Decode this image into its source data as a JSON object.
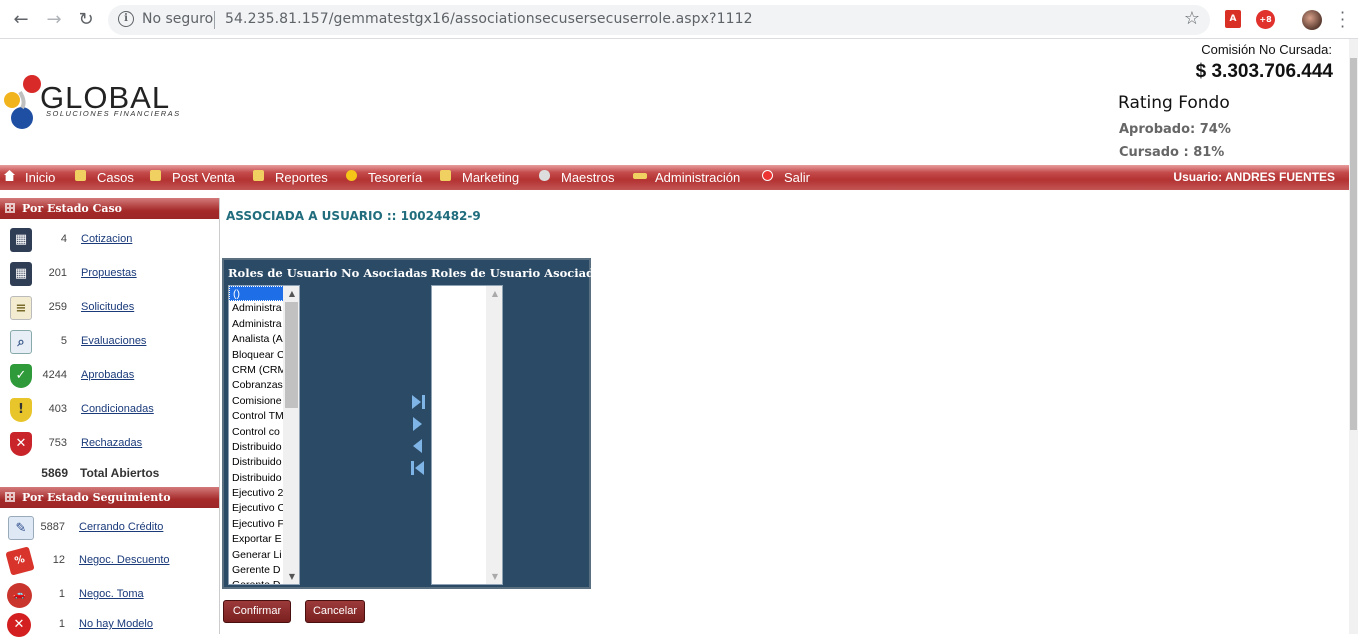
{
  "browser": {
    "insecure_label": "No seguro",
    "url": "54.235.81.157/gemmatestgx16/associationsecusersecuserrole.aspx?1112"
  },
  "header": {
    "logo_text": "GLOBAL",
    "logo_sub": "SOLUCIONES FINANCIERAS",
    "comision_label": "Comisión No Cursada:",
    "comision_value": "$ 3.303.706.444",
    "rating_title": "Rating Fondo",
    "aprobado": "Aprobado: 74%",
    "cursado": "Cursado : 81%"
  },
  "menu": {
    "items": [
      "Inicio",
      "Casos",
      "Post Venta",
      "Reportes",
      "Tesorería",
      "Marketing",
      "Maestros",
      "Administración",
      "Salir"
    ],
    "usuario": "Usuario:  ANDRES FUENTES"
  },
  "sidebar": {
    "estado_caso_title": "Por Estado Caso",
    "estado_caso": [
      {
        "count": "4",
        "label": "Cotizacion",
        "icon": "calculator-icon"
      },
      {
        "count": "201",
        "label": "Propuestas",
        "icon": "calculator-icon"
      },
      {
        "count": "259",
        "label": "Solicitudes",
        "icon": "notepad-icon"
      },
      {
        "count": "5",
        "label": "Evaluaciones",
        "icon": "magnifier-icon"
      },
      {
        "count": "4244",
        "label": "Aprobadas",
        "icon": "green-shield-icon"
      },
      {
        "count": "403",
        "label": "Condicionadas",
        "icon": "warning-shield-icon"
      },
      {
        "count": "753",
        "label": "Rechazadas",
        "icon": "red-shield-icon"
      }
    ],
    "total_count": "5869",
    "total_label": "Total Abiertos",
    "seguimiento_title": "Por Estado Seguimiento",
    "seguimiento": [
      {
        "count": "5887",
        "label": "Cerrando Crédito",
        "icon": "signing-icon"
      },
      {
        "count": "12",
        "label": "Negoc. Descuento",
        "icon": "discount-tag-icon"
      },
      {
        "count": "1",
        "label": "Negoc. Toma",
        "icon": "car-icon"
      },
      {
        "count": "1",
        "label": "No hay Modelo",
        "icon": "red-x-icon"
      }
    ]
  },
  "main": {
    "title": "ASSOCIADA A USUARIO :: 10024482-9",
    "no_asociadas_header": "Roles de Usuario No Asociadas",
    "asociadas_header": "Roles de Usuario Asociadas",
    "no_asociadas_items": [
      "()",
      "Administra",
      "Administra",
      "Analista (A",
      "Bloquear C",
      "CRM (CRM",
      "Cobranzas",
      "Comisione",
      "Control TM",
      "Control co",
      "Distribuido",
      "Distribuido",
      "Distribuido",
      "Ejecutivo 2",
      "Ejecutivo C",
      "Ejecutivo F",
      "Exportar E",
      "Generar Li",
      "Gerente D",
      "Gerente D"
    ],
    "asociadas_items": [],
    "confirm_label": "Confirmar",
    "cancel_label": "Cancelar"
  },
  "colors": {
    "menu_red": "#b43232",
    "panel_blue": "#2b4a66",
    "title_teal": "#216d7d",
    "link_blue": "#1a3a7a"
  }
}
